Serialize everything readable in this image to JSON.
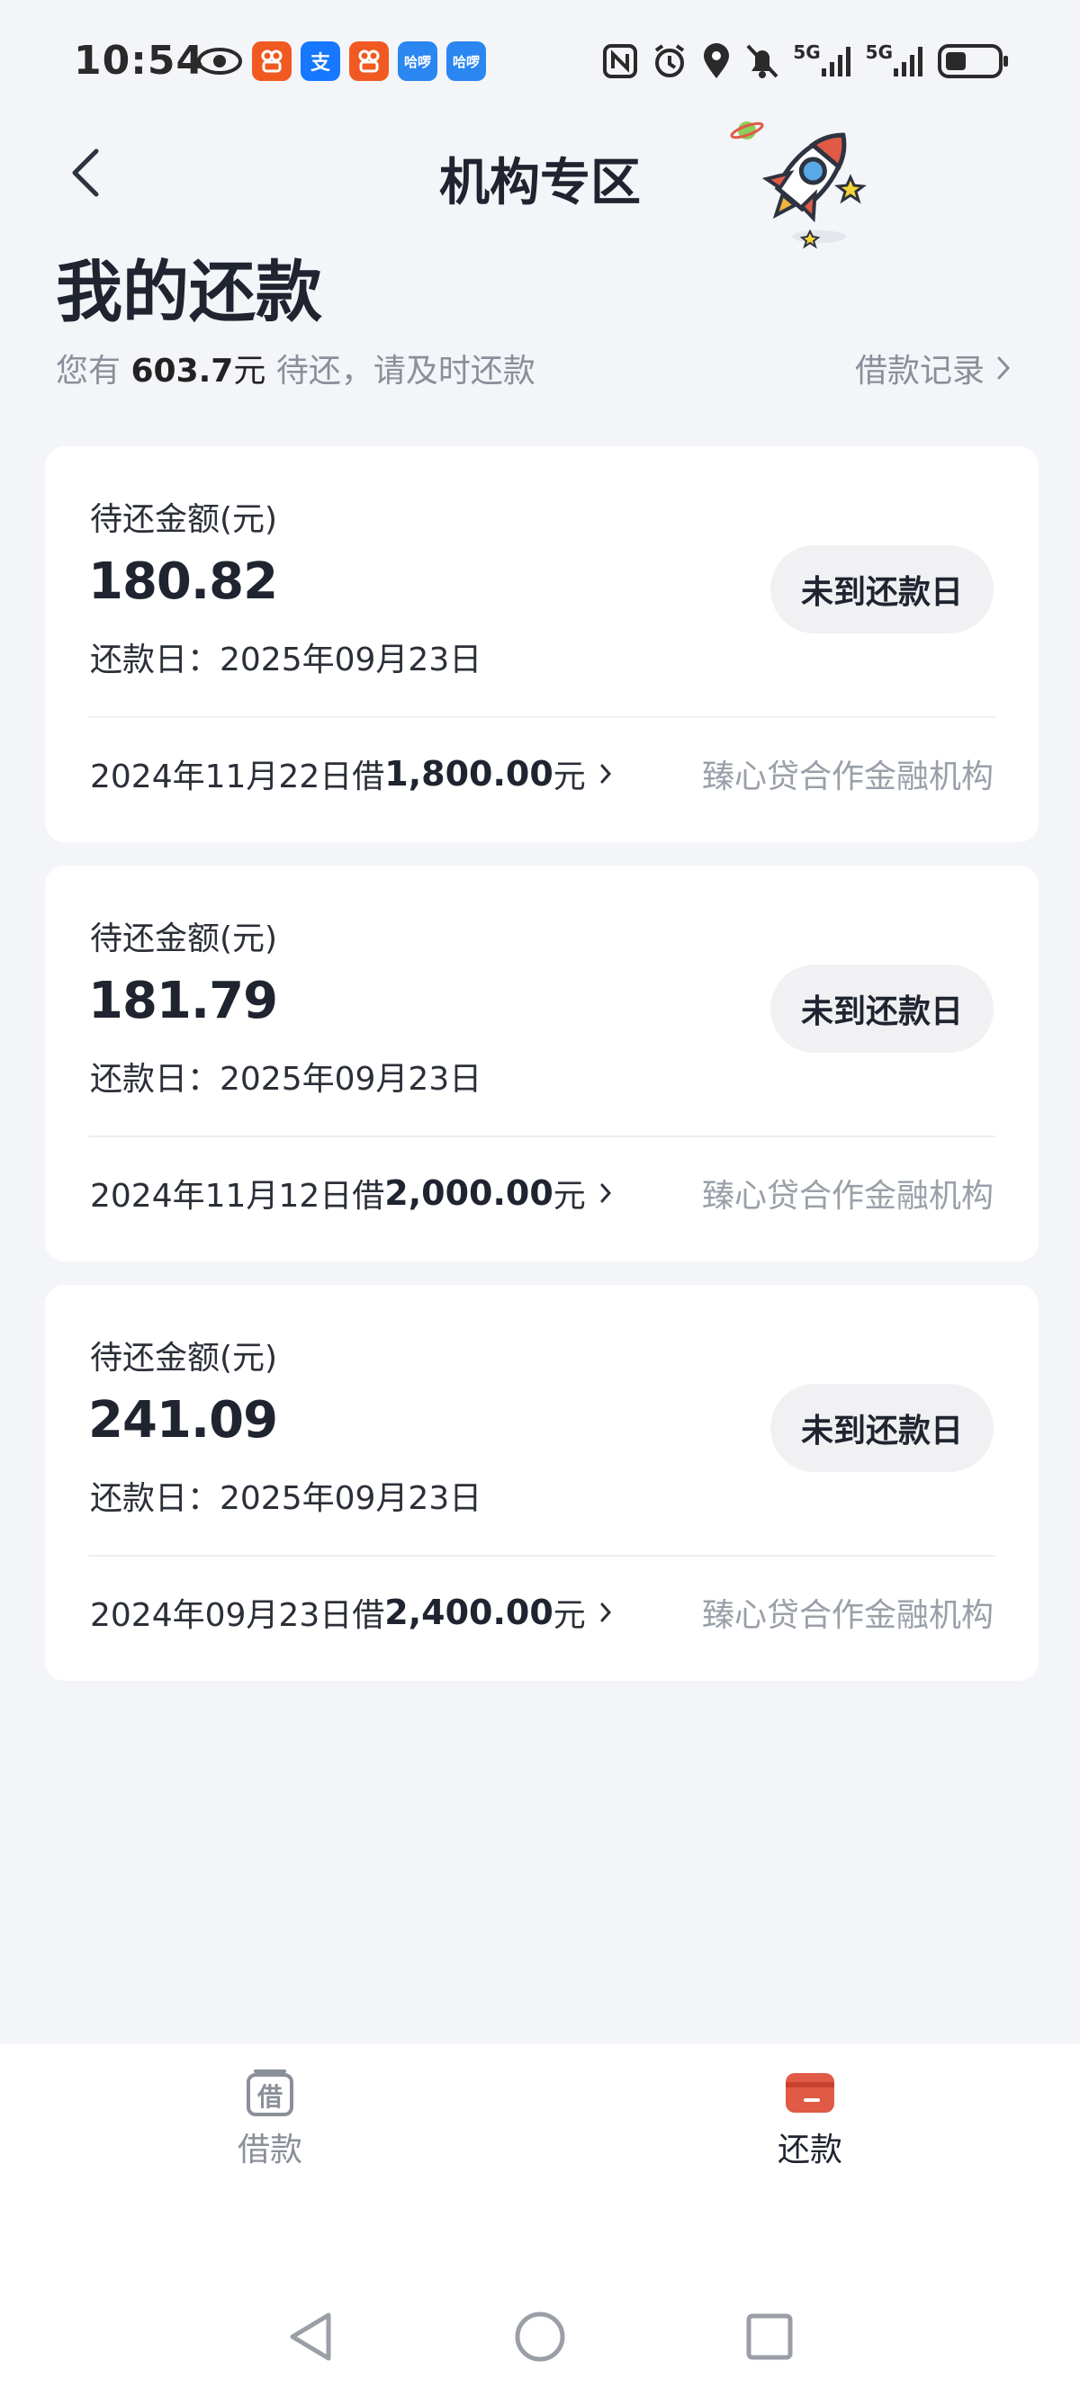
{
  "status_bar": {
    "time": "10:54",
    "app_icons": [
      {
        "name": "eye-icon",
        "glyph": "",
        "color": "#2a2a2a"
      },
      {
        "name": "kuaishou-icon",
        "glyph": "",
        "color": "#f05a22"
      },
      {
        "name": "alipay-icon",
        "glyph": "支",
        "color": "#1677ff"
      },
      {
        "name": "kuaishou-icon",
        "glyph": "",
        "color": "#f05a22"
      },
      {
        "name": "hello-icon",
        "glyph": "哈啰",
        "color": "#2a86f0"
      },
      {
        "name": "hello-icon",
        "glyph": "哈啰",
        "color": "#2a86f0"
      }
    ],
    "network_1": "5G",
    "network_2": "5G"
  },
  "header": {
    "title": "机构专区",
    "back_icon": "chevron-left-icon"
  },
  "summary": {
    "heading": "我的还款",
    "prefix": "您有",
    "amount": "603.7",
    "unit": "元",
    "suffix": "待还，请及时还款",
    "history_link": "借款记录"
  },
  "cards": [
    {
      "label": "待还金额(元)",
      "amount": "180.82",
      "due": "还款日：2025年09月23日",
      "status": "未到还款日",
      "loan_prefix": "2024年11月22日借",
      "loan_amount": "1,800.00",
      "loan_unit": "元",
      "institution": "臻心贷合作金融机构"
    },
    {
      "label": "待还金额(元)",
      "amount": "181.79",
      "due": "还款日：2025年09月23日",
      "status": "未到还款日",
      "loan_prefix": "2024年11月12日借",
      "loan_amount": "2,000.00",
      "loan_unit": "元",
      "institution": "臻心贷合作金融机构"
    },
    {
      "label": "待还金额(元)",
      "amount": "241.09",
      "due": "还款日：2025年09月23日",
      "status": "未到还款日",
      "loan_prefix": "2024年09月23日借",
      "loan_amount": "2,400.00",
      "loan_unit": "元",
      "institution": "臻心贷合作金融机构"
    }
  ],
  "bottom_nav": {
    "items": [
      {
        "label": "借款",
        "icon": "borrow-icon",
        "active": false
      },
      {
        "label": "还款",
        "icon": "repay-wallet-icon",
        "active": true
      }
    ]
  },
  "colors": {
    "background": "#f4f5f9",
    "card": "#ffffff",
    "accent_red": "#e05a45",
    "muted_text": "#8a8f99"
  }
}
